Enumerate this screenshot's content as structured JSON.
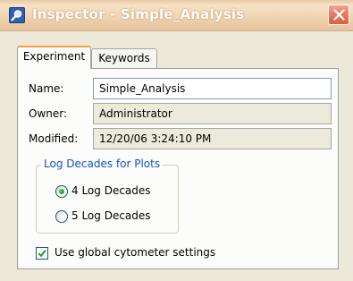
{
  "window": {
    "title": "Inspector - Simple_Analysis",
    "title_icon": "inspector-magnifier-icon",
    "close_icon": "close-icon"
  },
  "tabs": [
    {
      "label": "Experiment",
      "active": true
    },
    {
      "label": "Keywords",
      "active": false
    }
  ],
  "experiment": {
    "name_label": "Name:",
    "name_value": "Simple_Analysis",
    "owner_label": "Owner:",
    "owner_value": "Administrator",
    "modified_label": "Modified:",
    "modified_value": "12/20/06 3:24:10 PM"
  },
  "log_decades": {
    "group_label": "Log Decades for Plots",
    "options": [
      {
        "label": "4 Log Decades",
        "selected": true
      },
      {
        "label": "5 Log Decades",
        "selected": false
      }
    ]
  },
  "global_settings": {
    "label": "Use global cytometer settings",
    "checked": true
  },
  "colors": {
    "accent_tab": "#f2a040",
    "group_label": "#1452c7",
    "close_button": "#e57960"
  }
}
